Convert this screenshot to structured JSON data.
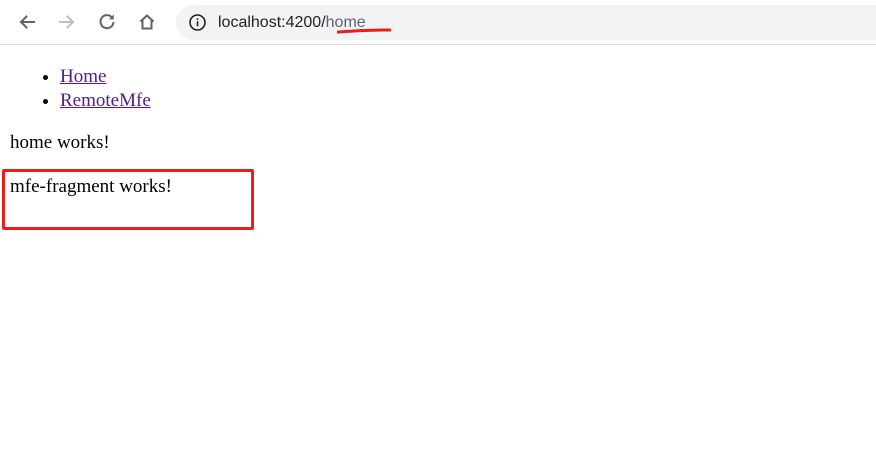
{
  "browser": {
    "url_host": "localhost:4200/",
    "url_path": "home",
    "icons": {
      "back": "arrow-left-icon",
      "forward": "arrow-right-icon",
      "reload": "reload-icon",
      "home": "home-icon",
      "site_info": "info-icon"
    },
    "forward_enabled": false
  },
  "page": {
    "nav": [
      {
        "label": "Home"
      },
      {
        "label": "RemoteMfe"
      }
    ],
    "home_text": "home works!",
    "fragment_text": "mfe-fragment works!"
  },
  "colors": {
    "link_visited": "#551a8b",
    "annotation_red": "#ee1c1c",
    "omnibox_bg": "#f1f3f4",
    "toolbar_icon": "#5f6368",
    "toolbar_icon_disabled": "#bdc1c6"
  }
}
